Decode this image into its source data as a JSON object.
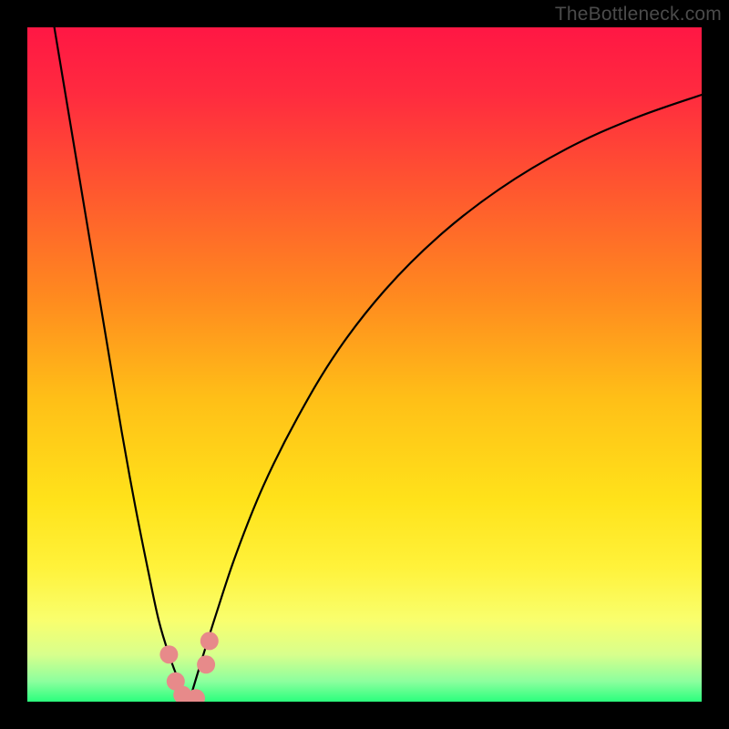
{
  "watermark": "TheBottleneck.com",
  "chart_data": {
    "type": "line",
    "title": "",
    "xlabel": "",
    "ylabel": "",
    "xlim": [
      0,
      100
    ],
    "ylim": [
      0,
      100
    ],
    "background_gradient": {
      "stops": [
        {
          "offset": 0.0,
          "color": "#ff1744"
        },
        {
          "offset": 0.1,
          "color": "#ff2b3f"
        },
        {
          "offset": 0.25,
          "color": "#ff5a2e"
        },
        {
          "offset": 0.4,
          "color": "#ff8a1f"
        },
        {
          "offset": 0.55,
          "color": "#ffbf17"
        },
        {
          "offset": 0.7,
          "color": "#ffe21a"
        },
        {
          "offset": 0.8,
          "color": "#fff23a"
        },
        {
          "offset": 0.88,
          "color": "#f9ff6e"
        },
        {
          "offset": 0.93,
          "color": "#d8ff8c"
        },
        {
          "offset": 0.97,
          "color": "#8cff9e"
        },
        {
          "offset": 1.0,
          "color": "#2bff7d"
        }
      ]
    },
    "series": [
      {
        "name": "left-curve",
        "stroke": "#000000",
        "stroke_width": 2.2,
        "x": [
          4.0,
          6.0,
          8.0,
          10.0,
          12.0,
          14.0,
          16.0,
          18.0,
          19.5,
          21.0,
          22.5,
          24.0
        ],
        "y": [
          100.0,
          88.0,
          76.0,
          64.0,
          52.0,
          40.0,
          29.0,
          19.0,
          12.0,
          7.0,
          3.0,
          0.0
        ]
      },
      {
        "name": "right-curve",
        "stroke": "#000000",
        "stroke_width": 2.2,
        "x": [
          24.0,
          25.5,
          28.0,
          31.0,
          35.0,
          40.0,
          46.0,
          53.0,
          61.0,
          70.0,
          80.0,
          90.0,
          100.0
        ],
        "y": [
          0.0,
          5.0,
          13.0,
          22.0,
          32.0,
          42.0,
          52.0,
          61.0,
          69.0,
          76.0,
          82.0,
          86.5,
          90.0
        ]
      }
    ],
    "markers": {
      "name": "highlighted-points",
      "color": "#E78A8A",
      "radius": 10,
      "points": [
        {
          "x": 21.0,
          "y": 7.0
        },
        {
          "x": 22.0,
          "y": 3.0
        },
        {
          "x": 23.0,
          "y": 1.0
        },
        {
          "x": 24.0,
          "y": 0.0
        },
        {
          "x": 25.0,
          "y": 0.5
        },
        {
          "x": 26.5,
          "y": 5.5
        },
        {
          "x": 27.0,
          "y": 9.0
        }
      ]
    }
  }
}
